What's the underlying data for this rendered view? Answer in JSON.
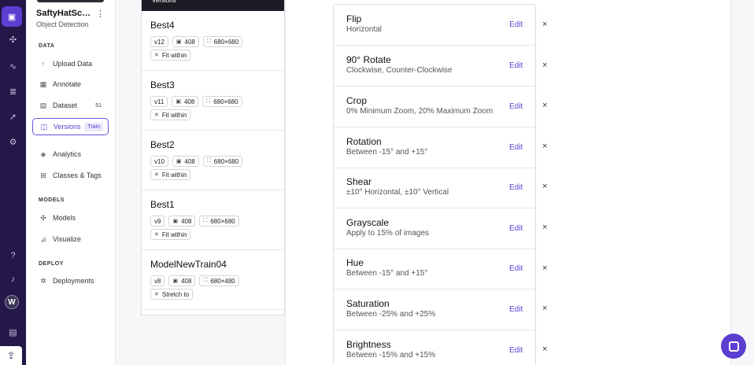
{
  "rail": {
    "avatar_initial": "W"
  },
  "project": {
    "name": "SaftyHatSca...",
    "type": "Object Detection",
    "menu_icon": "⋮"
  },
  "sections": {
    "data": "DATA",
    "models": "MODELS",
    "deploy": "DEPLOY"
  },
  "nav": {
    "upload": "Upload Data",
    "annotate": "Annotate",
    "dataset": "Dataset",
    "dataset_count": "51",
    "versions": "Versions",
    "versions_pill": "Train",
    "analytics": "Analytics",
    "classes": "Classes & Tags",
    "models": "Models",
    "visualize": "Visualize",
    "deployments": "Deployments"
  },
  "versions_header": "Versions",
  "versions": [
    {
      "name": "Best4",
      "ver": "v12",
      "images": "408",
      "size": "680×680",
      "resize": "Fit within"
    },
    {
      "name": "Best3",
      "ver": "v11",
      "images": "408",
      "size": "680×680",
      "resize": "Fit within"
    },
    {
      "name": "Best2",
      "ver": "v10",
      "images": "408",
      "size": "680×680",
      "resize": "Fit within"
    },
    {
      "name": "Best1",
      "ver": "v9",
      "images": "408",
      "size": "680×680",
      "resize": "Fit within"
    },
    {
      "name": "ModelNewTrain04",
      "ver": "v8",
      "images": "408",
      "size": "680×480",
      "resize": "Stretch to"
    }
  ],
  "edit_label": "Edit",
  "remove_icon": "×",
  "augmentations": [
    {
      "name": "Flip",
      "desc": "Horizontal"
    },
    {
      "name": "90° Rotate",
      "desc": "Clockwise, Counter-Clockwise"
    },
    {
      "name": "Crop",
      "desc": "0% Minimum Zoom, 20% Maximum Zoom"
    },
    {
      "name": "Rotation",
      "desc": "Between -15° and +15°"
    },
    {
      "name": "Shear",
      "desc": "±10° Horizontal, ±10° Vertical"
    },
    {
      "name": "Grayscale",
      "desc": "Apply to 15% of images"
    },
    {
      "name": "Hue",
      "desc": "Between -15° and +15°"
    },
    {
      "name": "Saturation",
      "desc": "Between -25% and +25%"
    },
    {
      "name": "Brightness",
      "desc": "Between -15% and +15%"
    }
  ],
  "colors": {
    "accent": "#5b3fd1",
    "rail": "#231848"
  }
}
